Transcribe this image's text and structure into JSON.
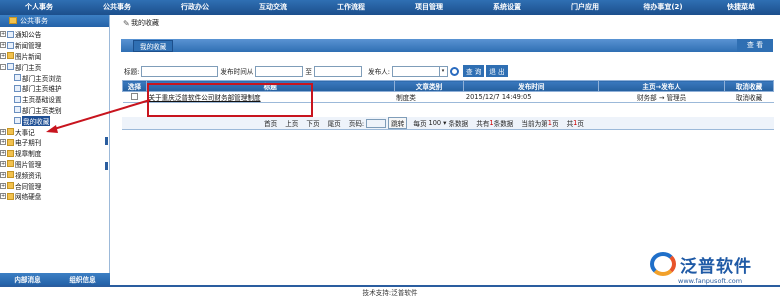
{
  "topnav": [
    "个人事务",
    "公共事务",
    "行政办公",
    "互动交流",
    "工作流程",
    "项目管理",
    "系统设置",
    "门户应用",
    "待办事宜(2)",
    "快捷菜单"
  ],
  "sidebar": {
    "header": "公共事务",
    "items": [
      {
        "label": "通知公告",
        "level": 0,
        "expand": "+",
        "icon": "doc"
      },
      {
        "label": "新闻管理",
        "level": 0,
        "expand": "+",
        "icon": "doc"
      },
      {
        "label": "图片新闻",
        "level": 0,
        "expand": "+",
        "icon": "folder"
      },
      {
        "label": "部门主页",
        "level": 0,
        "expand": "-",
        "icon": "doc"
      },
      {
        "label": "部门主页浏览",
        "level": 1,
        "icon": "doc"
      },
      {
        "label": "部门主页维护",
        "level": 1,
        "icon": "doc"
      },
      {
        "label": "主页基础设置",
        "level": 1,
        "icon": "doc"
      },
      {
        "label": "部门主页类别",
        "level": 1,
        "icon": "doc"
      },
      {
        "label": "我的收藏",
        "level": 1,
        "icon": "doc",
        "active": true
      },
      {
        "label": "大事记",
        "level": 0,
        "expand": "+",
        "icon": "folder"
      },
      {
        "label": "电子期刊",
        "level": 0,
        "expand": "+",
        "icon": "folder"
      },
      {
        "label": "规章制度",
        "level": 0,
        "expand": "+",
        "icon": "folder"
      },
      {
        "label": "图片管理",
        "level": 0,
        "expand": "+",
        "icon": "folder"
      },
      {
        "label": "视频资讯",
        "level": 0,
        "expand": "+",
        "icon": "folder"
      },
      {
        "label": "合同管理",
        "level": 0,
        "expand": "+",
        "icon": "folder"
      },
      {
        "label": "网络硬盘",
        "level": 0,
        "expand": "+",
        "icon": "folder"
      }
    ],
    "footer": {
      "left": "内部消息",
      "right": "组织信息"
    }
  },
  "main": {
    "breadcrumb": "我的收藏",
    "tab": "我的收藏",
    "view_button": "查 看",
    "search": {
      "title_label": "标题:",
      "from_label": "发布时间从",
      "to_label": "至",
      "publisher_label": "发布人:",
      "query": "查 询",
      "exit": "退 出"
    },
    "columns": [
      "选择",
      "标题",
      "文章类别",
      "发布时间",
      "主页→发布人",
      "取消收藏"
    ],
    "rows": [
      {
        "title": "关于重庆泛普软件公司财务部管理制度",
        "category": "制度类",
        "time": "2015/12/7 14:49:05",
        "publisher": "财务部 → 管理员",
        "action": "取消收藏"
      }
    ],
    "pager": {
      "first": "首页",
      "prev": "上页",
      "next": "下页",
      "last": "尾页",
      "page_label": "页码:",
      "go": "跳转",
      "per_page_label": "每页",
      "per_page": "100",
      "per_unit": "条数据",
      "total_pre": "共有",
      "total": "1",
      "total_post": "条数据",
      "current_pre": "当前为第",
      "current": "1",
      "current_post": "页",
      "pages_pre": "共",
      "pages": "1",
      "pages_post": "页"
    }
  },
  "footer": "技术支持:泛普软件",
  "logo": {
    "name": "泛普软件",
    "url": "www.fanpusoft.com"
  }
}
